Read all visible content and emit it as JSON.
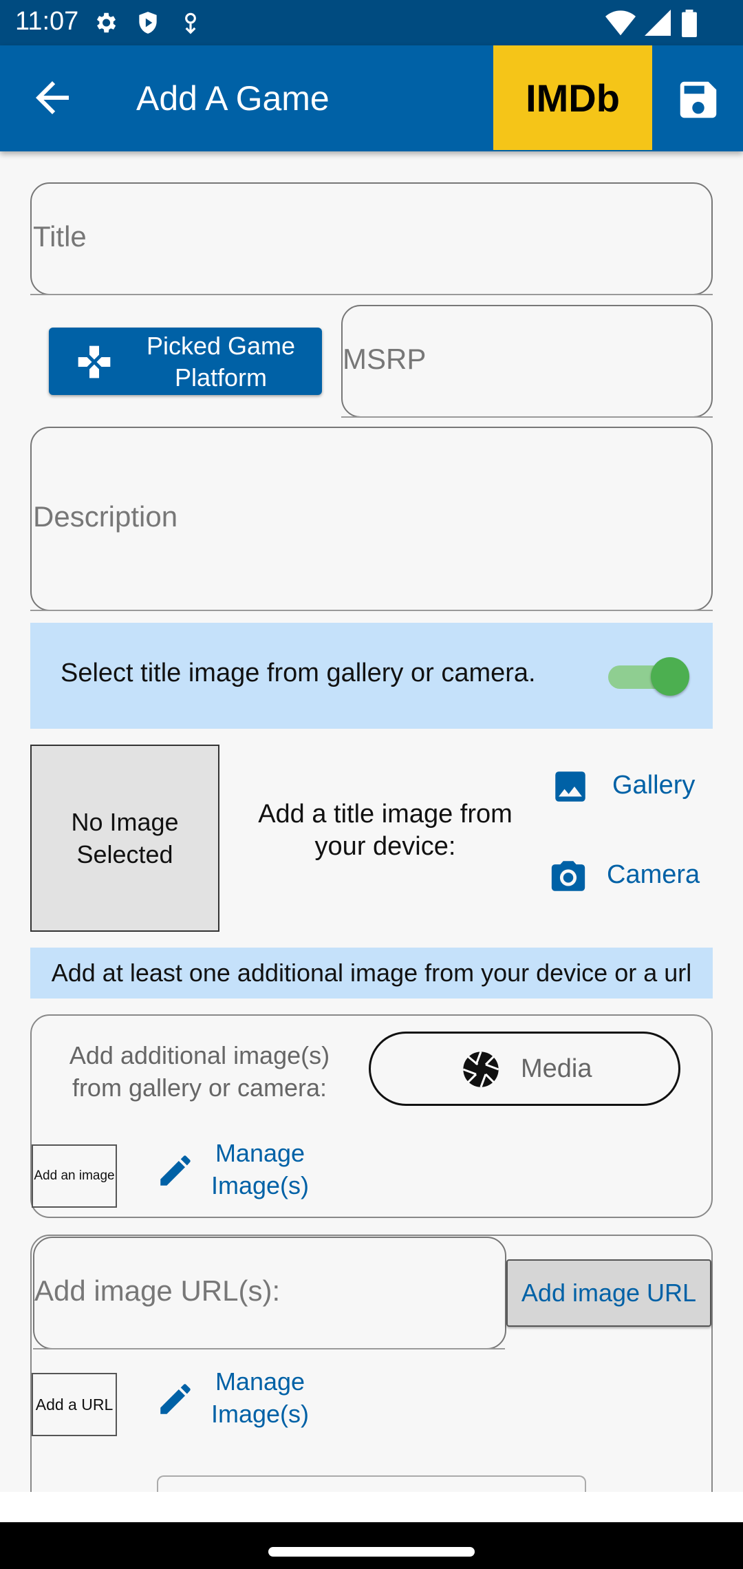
{
  "status_bar": {
    "time": "11:07"
  },
  "app_bar": {
    "title": "Add A Game",
    "imdb_label": "IMDb"
  },
  "fields": {
    "title_label": "Title",
    "msrp_label": "MSRP",
    "description_label": "Description",
    "image_url_label": "Add image URL(s):"
  },
  "platform_button": {
    "label": "Picked Game Platform"
  },
  "title_image": {
    "toggle_text": "Select title image from gallery or camera.",
    "toggle_on": true,
    "no_image_text": "No Image Selected",
    "add_from_device": "Add a title image from your device:",
    "gallery_label": "Gallery",
    "camera_label": "Camera"
  },
  "additional": {
    "banner_text": "Add at least one additional image from your device or a url",
    "gallery_camera_text": "Add additional image(s) from gallery or camera:",
    "media_label": "Media",
    "add_image_thumb": "Add an image",
    "manage_images_1": "Manage Image(s)",
    "add_url_button": "Add image URL",
    "add_url_thumb": "Add a URL",
    "manage_images_2": "Manage Image(s)"
  },
  "colors": {
    "primary": "#0061a6",
    "status_bar": "#004b80",
    "imdb": "#f5c518",
    "banner": "#c5e1fa",
    "toggle": "#4caf50"
  }
}
